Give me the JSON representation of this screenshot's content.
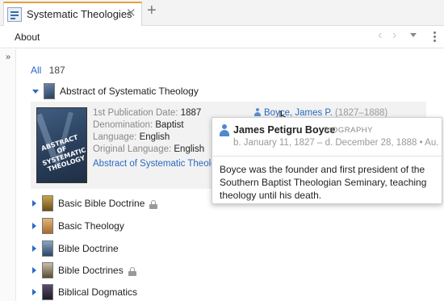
{
  "tab": {
    "title": "Systematic Theologies",
    "close": "✕",
    "add": "+",
    "accent": "#e7a13b"
  },
  "toolbar": {
    "about": "About",
    "back": "‹",
    "forward": "›",
    "expand": "»"
  },
  "all": {
    "label": "All",
    "count": "187"
  },
  "expanded_item": {
    "title": "Abstract of Systematic Theology",
    "cover_text": "ABSTRACT OF SYSTEMATIC THEOLOGY",
    "first_pub_label": "1st Publication Date:",
    "first_pub_value": "1887",
    "denomination_label": "Denomination:",
    "denomination_value": "Baptist",
    "language_label": "Language:",
    "language_value": "English",
    "orig_language_label": "Original Language:",
    "orig_language_value": "English",
    "link": "Abstract of Systematic Theology",
    "author_name": "Boyce, James P.",
    "author_dates": "(1827–1888)"
  },
  "items": [
    {
      "label": "Basic Bible Doctrine",
      "locked": true
    },
    {
      "label": "Basic Theology",
      "locked": false
    },
    {
      "label": "Bible Doctrine",
      "locked": false
    },
    {
      "label": "Bible Doctrines",
      "locked": true
    },
    {
      "label": "Biblical Dogmatics",
      "locked": false
    }
  ],
  "popup": {
    "name": "James Petigru Boyce",
    "type": "BIOGRAPHY",
    "dates": "b. January 11, 1827 – d. December 28, 1888 • Au...",
    "body": "Boyce was the founder and first president of the Southern Baptist Theologian Seminary, teaching theology until his death."
  },
  "colors": {
    "link": "#2a6ac0",
    "muted": "#888888",
    "lock": "#999999"
  }
}
